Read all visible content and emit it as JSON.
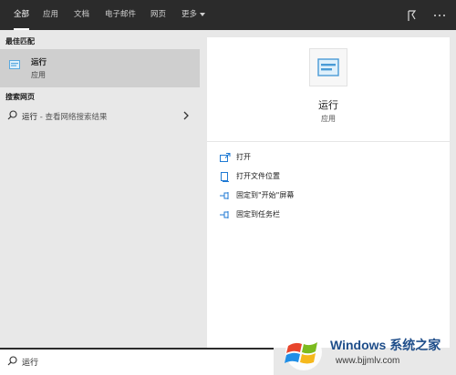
{
  "tabs": [
    {
      "label": "全部",
      "active": true
    },
    {
      "label": "应用",
      "active": false
    },
    {
      "label": "文档",
      "active": false
    },
    {
      "label": "电子邮件",
      "active": false
    },
    {
      "label": "网页",
      "active": false
    },
    {
      "label": "更多",
      "active": false
    }
  ],
  "topbar_icons": [
    "feedback-icon",
    "more-options-icon"
  ],
  "left": {
    "best_match_header": "最佳匹配",
    "best_match": {
      "title": "运行",
      "subtitle": "应用",
      "icon": "run-app-icon"
    },
    "web_header": "搜索网页",
    "web_result": {
      "query": "运行",
      "suffix": " - 查看网络搜索结果"
    }
  },
  "right": {
    "app_name": "运行",
    "app_type": "应用",
    "actions": [
      {
        "label": "打开",
        "icon": "open-icon"
      },
      {
        "label": "打开文件位置",
        "icon": "file-location-icon"
      },
      {
        "label": "固定到\"开始\"屏幕",
        "icon": "pin-start-icon"
      },
      {
        "label": "固定到任务栏",
        "icon": "pin-taskbar-icon"
      }
    ]
  },
  "search": {
    "value": "运行"
  },
  "watermark": {
    "title": "Windows 系统之家",
    "url": "www.bjjmlv.com"
  },
  "colors": {
    "topbar": "#2b2b2b",
    "accent": "#1f7ad4",
    "selected": "#cfcfcf"
  }
}
